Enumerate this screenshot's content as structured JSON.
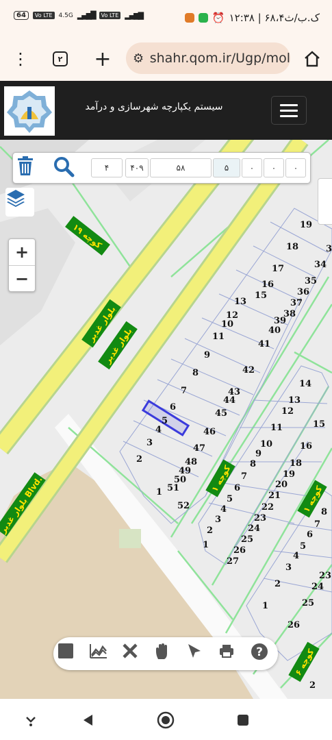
{
  "status_bar": {
    "battery": "64",
    "network_tag_1": "Vo LTE",
    "network_type": "4.5G",
    "network_tag_2": "Vo LTE",
    "clock": "۱۲:۳۸ | ۶۸،۴ک.ب/ث"
  },
  "browser": {
    "tab_count": "۲",
    "url": "shahr.qom.ir/Ugp/mol"
  },
  "app": {
    "title": "سیستم یکپارچه شهرسازی و درآمد"
  },
  "parcel_search": {
    "cells": [
      "۴",
      "۴۰۹",
      "۵۸",
      "۵",
      "۰",
      "۰",
      "۰"
    ]
  },
  "map": {
    "road_labels": [
      "کوچه ۱۹",
      "بلوار غدیر",
      "بلوار غدیر",
      "بلوار غدیر Blvd.",
      "کوچه ۱",
      "کوچه ۱",
      "کوچه ۶"
    ],
    "selected_parcel": "5",
    "parcel_numbers_block_a": [
      "19",
      "18",
      "17",
      "16",
      "15",
      "13",
      "12",
      "10",
      "11",
      "9",
      "8",
      "7",
      "6",
      "5",
      "4",
      "3",
      "2",
      "1",
      "3",
      "34",
      "35",
      "36",
      "37",
      "38",
      "39",
      "40",
      "41",
      "42",
      "43",
      "44",
      "45",
      "46",
      "47",
      "48",
      "49",
      "50",
      "51",
      "52"
    ],
    "parcel_numbers_block_b": [
      "14",
      "13",
      "12",
      "11",
      "15",
      "10",
      "16",
      "9",
      "18",
      "8",
      "19",
      "7",
      "20",
      "6",
      "21",
      "5",
      "22",
      "4",
      "23",
      "3",
      "24",
      "2",
      "25",
      "1",
      "26",
      "27"
    ],
    "parcel_numbers_block_c": [
      "8",
      "7",
      "6",
      "5",
      "4",
      "3",
      "2",
      "1",
      "23",
      "24",
      "25",
      "26",
      "2"
    ],
    "colors": {
      "boulevard": "#f2f07a",
      "street_green": "#8fe39a",
      "label_bg": "#128a12",
      "label_text": "#ffe200",
      "sand": "#e3d3b8",
      "parcel_lines": "#9aa6d4",
      "selection": "#3b3bdc"
    }
  },
  "icons": {
    "trash": "trash-icon",
    "search": "search-icon",
    "layers": "layers-icon",
    "zoom_in": "+",
    "zoom_out": "−"
  },
  "bottom_toolbar": [
    "stop-icon",
    "chart-icon",
    "close-icon",
    "hand-icon",
    "pointer-icon",
    "print-icon",
    "help-icon"
  ]
}
